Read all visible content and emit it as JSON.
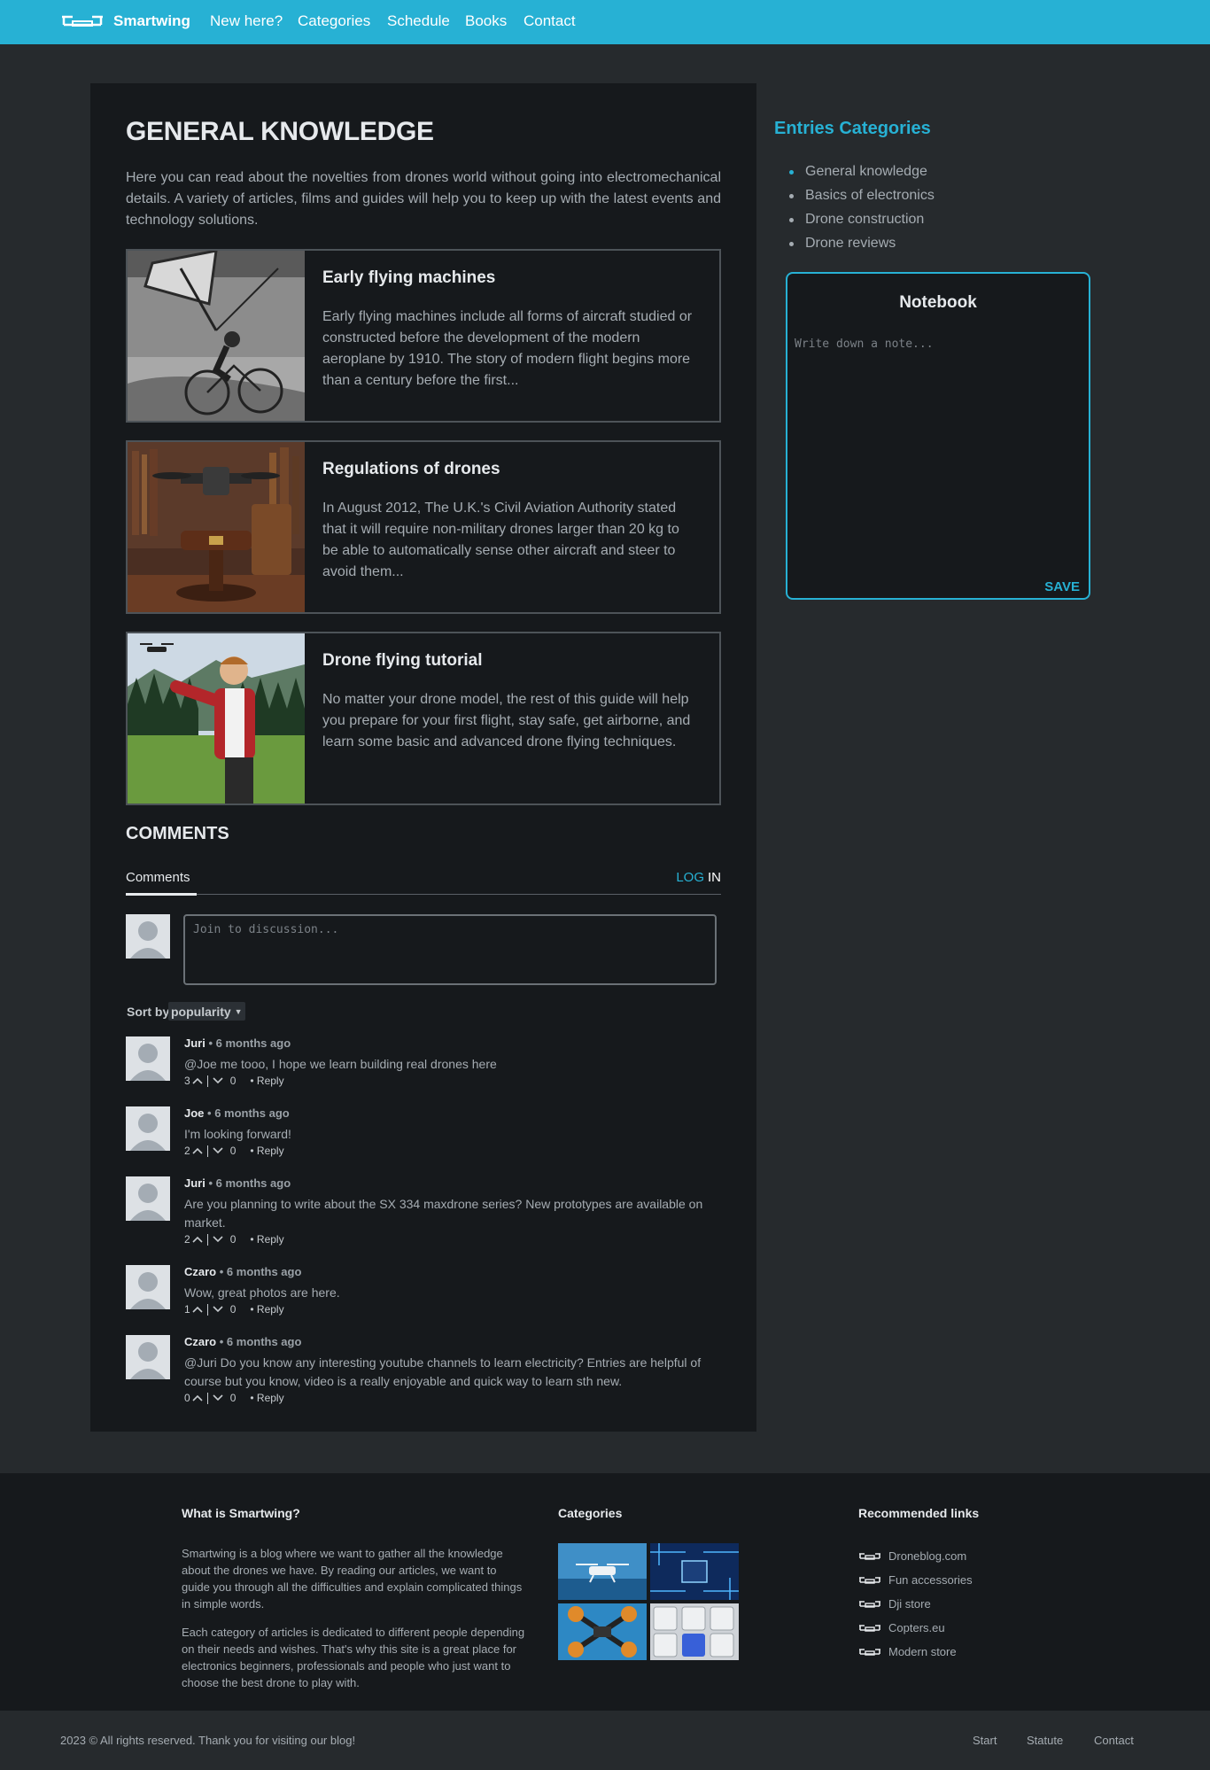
{
  "nav": {
    "brand": "Smartwing",
    "links": [
      "New here?",
      "Categories",
      "Schedule",
      "Books",
      "Contact"
    ]
  },
  "main": {
    "title": "GENERAL KNOWLEDGE",
    "intro": "Here you can read about the novelties from drones world without going into electromechanical details. A variety of articles, films and guides will help you to keep up with the latest events and technology solutions.",
    "articles": [
      {
        "title": "Early flying machines",
        "text": "Early flying machines include all forms of aircraft studied or constructed before the development of the modern aeroplane by 1910. The story of modern flight begins more than a century before the first..."
      },
      {
        "title": "Regulations of drones",
        "text": "In August 2012, The U.K.'s Civil Aviation Authority stated that it will require non-military drones larger than 20 kg to be able to automatically sense other aircraft and steer to avoid them..."
      },
      {
        "title": "Drone flying tutorial",
        "text": "No matter your drone model, the rest of this guide will help you prepare for your first flight, stay safe, get airborne, and learn some basic and advanced drone flying techniques."
      }
    ]
  },
  "comments": {
    "heading": "COMMENTS",
    "tab": "Comments",
    "login_log": "LOG",
    "login_in": "IN",
    "input_placeholder": "Join to discussion...",
    "sort_label": "Sort by",
    "sort_value": "popularity",
    "reply_label": "• Reply",
    "items": [
      {
        "author": "Juri",
        "time": "• 6 months ago",
        "text": "@Joe me tooo, I hope we learn building real drones here",
        "up": "3",
        "down": "0"
      },
      {
        "author": "Joe",
        "time": "• 6 months ago",
        "text": "I'm looking forward!",
        "up": "2",
        "down": "0"
      },
      {
        "author": "Juri",
        "time": "• 6 months ago",
        "text": "Are you planning to write about the SX 334 maxdrone series? New prototypes are available on market.",
        "up": "2",
        "down": "0"
      },
      {
        "author": "Czaro",
        "time": "• 6 months ago",
        "text": "Wow, great photos are here.",
        "up": "1",
        "down": "0"
      },
      {
        "author": "Czaro",
        "time": "• 6 months ago",
        "text": "@Juri Do you know any interesting youtube channels to learn electricity? Entries are helpful of course but you know, video is a really enjoyable and quick way to learn sth new.",
        "up": "0",
        "down": "0"
      }
    ]
  },
  "sidebar": {
    "title": "Entries Categories",
    "categories": [
      "General knowledge",
      "Basics of electronics",
      "Drone construction",
      "Drone reviews"
    ]
  },
  "notebook": {
    "title": "Notebook",
    "placeholder": "Write down a note...",
    "save": "SAVE"
  },
  "footer": {
    "about_heading": "What is Smartwing?",
    "about_p1": "Smartwing is a blog where we want to gather all the knowledge about the drones we have. By reading our articles, we want to guide you through all the difficulties and explain complicated things in simple words.",
    "about_p2": "Each category of articles is dedicated to different people depending on their needs and wishes. That's why this site is a great place for electronics beginners, professionals and people who just want to choose the best drone to play with.",
    "categories_heading": "Categories",
    "links_heading": "Recommended links",
    "links": [
      "Droneblog.com",
      "Fun accessories",
      "Dji store",
      "Copters.eu",
      "Modern store"
    ],
    "copyright": "2023 © All rights reserved. Thank you for visiting our blog!",
    "bottom_links": [
      "Start",
      "Statute",
      "Contact"
    ]
  },
  "colors": {
    "accent": "#27b1d4",
    "page_bg": "#262a2d",
    "card_bg": "#16191c",
    "text_muted": "#a5acb2",
    "text_bright": "#e6e9ec"
  }
}
